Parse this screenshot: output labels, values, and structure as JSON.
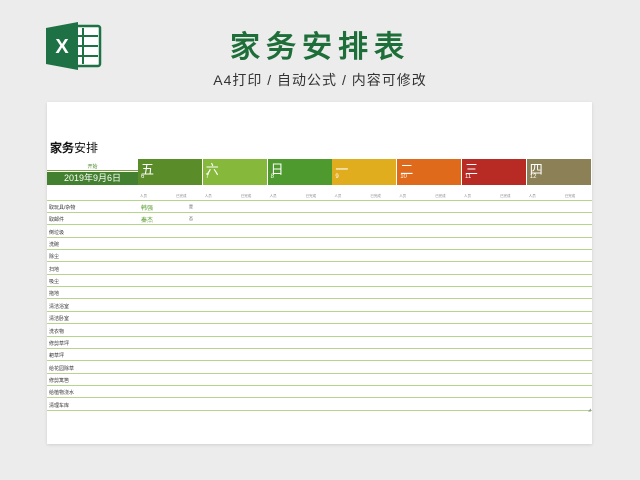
{
  "header": {
    "title": "家务安排表",
    "subtitle": "A4打印 / 自动公式 / 内容可修改",
    "logo_icon": "excel-icon",
    "logo_color": "#1e7145"
  },
  "sheet": {
    "title_bold": "家务",
    "title_rest": "安排",
    "start_label": "开始",
    "start_date": "2019年9月6日",
    "days": [
      {
        "name": "五",
        "num": "6",
        "color": "#5b8c2a"
      },
      {
        "name": "六",
        "num": "7",
        "color": "#86b83c"
      },
      {
        "name": "日",
        "num": "8",
        "color": "#4e9a2e"
      },
      {
        "name": "一",
        "num": "9",
        "color": "#e0ad1f"
      },
      {
        "name": "二",
        "num": "10",
        "color": "#e06a1c"
      },
      {
        "name": "三",
        "num": "11",
        "color": "#b82a24"
      },
      {
        "name": "四",
        "num": "12",
        "color": "#8c8156"
      }
    ],
    "col_person": "人员",
    "col_done": "已完成",
    "tasks": [
      {
        "task": "取玩具/杂物",
        "person": "韩强",
        "done": "是"
      },
      {
        "task": "取邮件",
        "person": "秦杰",
        "done": "否"
      },
      {
        "task": "倒垃圾",
        "person": "",
        "done": ""
      },
      {
        "task": "洗碗",
        "person": "",
        "done": ""
      },
      {
        "task": "除尘",
        "person": "",
        "done": ""
      },
      {
        "task": "扫地",
        "person": "",
        "done": ""
      },
      {
        "task": "吸尘",
        "person": "",
        "done": ""
      },
      {
        "task": "拖地",
        "person": "",
        "done": ""
      },
      {
        "task": "清洁浴室",
        "person": "",
        "done": ""
      },
      {
        "task": "清洁卧室",
        "person": "",
        "done": ""
      },
      {
        "task": "洗衣物",
        "person": "",
        "done": ""
      },
      {
        "task": "修剪草坪",
        "person": "",
        "done": ""
      },
      {
        "task": "耙草坪",
        "person": "",
        "done": ""
      },
      {
        "task": "给花园除草",
        "person": "",
        "done": ""
      },
      {
        "task": "修剪篱笆",
        "person": "",
        "done": ""
      },
      {
        "task": "给植物浇水",
        "person": "",
        "done": ""
      },
      {
        "task": "清理车库",
        "person": "",
        "done": ""
      }
    ]
  }
}
